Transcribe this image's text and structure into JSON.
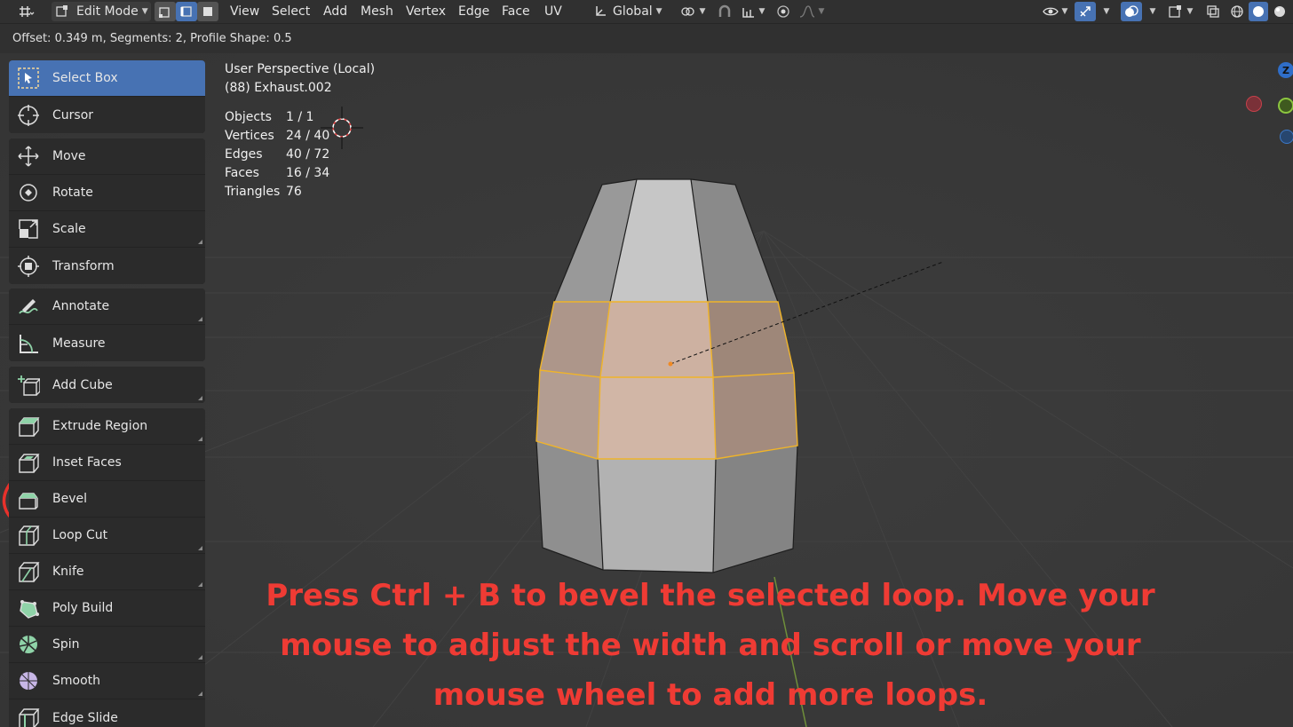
{
  "header": {
    "mode_label": "Edit Mode",
    "menus": [
      "View",
      "Select",
      "Add",
      "Mesh",
      "Vertex",
      "Edge",
      "Face",
      "UV"
    ],
    "transform_orientation": "Global",
    "select_mode": "edge"
  },
  "redo_panel": {
    "text": "Offset: 0.349 m, Segments: 2, Profile Shape: 0.5"
  },
  "viewport": {
    "title": "User Perspective (Local)",
    "object": "(88) Exhaust.002",
    "stats": [
      {
        "label": "Objects",
        "value": "1 / 1"
      },
      {
        "label": "Vertices",
        "value": "24 / 40"
      },
      {
        "label": "Edges",
        "value": "40 / 72"
      },
      {
        "label": "Faces",
        "value": "16 / 34"
      },
      {
        "label": "Triangles",
        "value": "76"
      }
    ],
    "gizmo_z_label": "Z"
  },
  "toolbar": {
    "tools": [
      {
        "label": "Select Box",
        "icon": "select-box-icon",
        "active": true
      },
      {
        "label": "Cursor",
        "icon": "cursor-icon"
      },
      {
        "label": "Move",
        "icon": "move-icon"
      },
      {
        "label": "Rotate",
        "icon": "rotate-icon"
      },
      {
        "label": "Scale",
        "icon": "scale-icon"
      },
      {
        "label": "Transform",
        "icon": "transform-icon"
      },
      {
        "label": "Annotate",
        "icon": "annotate-icon"
      },
      {
        "label": "Measure",
        "icon": "measure-icon"
      },
      {
        "label": "Add Cube",
        "icon": "add-cube-icon"
      },
      {
        "label": "Extrude Region",
        "icon": "extrude-region-icon"
      },
      {
        "label": "Inset Faces",
        "icon": "inset-faces-icon"
      },
      {
        "label": "Bevel",
        "icon": "bevel-icon"
      },
      {
        "label": "Loop Cut",
        "icon": "loop-cut-icon"
      },
      {
        "label": "Knife",
        "icon": "knife-icon"
      },
      {
        "label": "Poly Build",
        "icon": "poly-build-icon"
      },
      {
        "label": "Spin",
        "icon": "spin-icon"
      },
      {
        "label": "Smooth",
        "icon": "smooth-icon"
      },
      {
        "label": "Edge Slide",
        "icon": "edge-slide-icon"
      }
    ]
  },
  "caption": {
    "text": "Press Ctrl + B to bevel the selected loop. Move your mouse to adjust the width and scroll or move your mouse wheel to add more loops."
  },
  "colors": {
    "selection": "#f0b429",
    "annotation_red": "#e8312b",
    "active_tool": "#4772b3"
  }
}
